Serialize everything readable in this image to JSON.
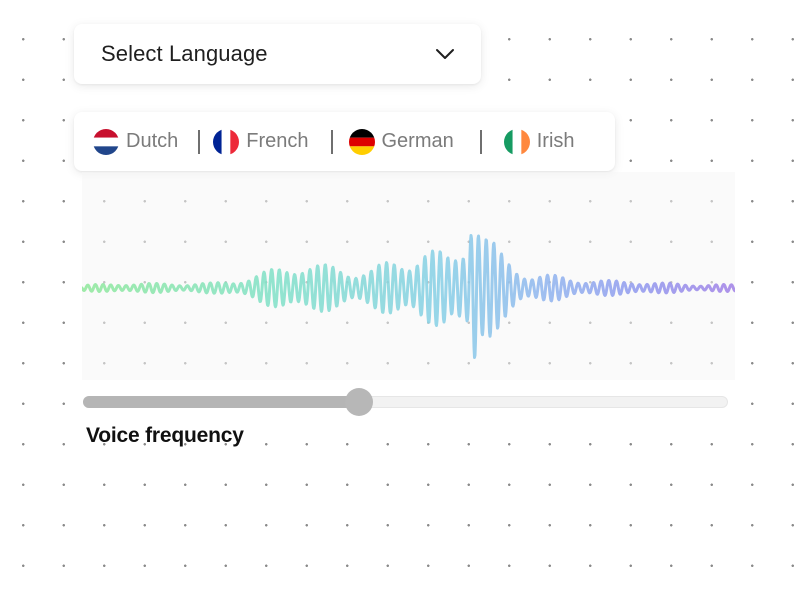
{
  "language_select": {
    "label": "Select Language",
    "icon": "chevron-down-icon"
  },
  "languages": [
    {
      "name": "Dutch",
      "flag": "netherlands-flag-icon",
      "colors": [
        "#c8102e",
        "#ffffff",
        "#21468b"
      ]
    },
    {
      "name": "French",
      "flag": "france-flag-icon",
      "colors": [
        "#002395",
        "#ffffff",
        "#ed2939"
      ]
    },
    {
      "name": "German",
      "flag": "germany-flag-icon",
      "colors": [
        "#000000",
        "#dd0000",
        "#ffce00"
      ]
    },
    {
      "name": "Irish",
      "flag": "ireland-flag-icon",
      "colors": [
        "#169b62",
        "#ffffff",
        "#ff883e"
      ]
    }
  ],
  "waveform": {
    "gradient": [
      "#8ee89a",
      "#7fe0c8",
      "#86cfe6",
      "#8fb6ee",
      "#8f98ee",
      "#a07fe6"
    ]
  },
  "slider": {
    "label": "Voice frequency",
    "value_fraction": 0.428
  }
}
